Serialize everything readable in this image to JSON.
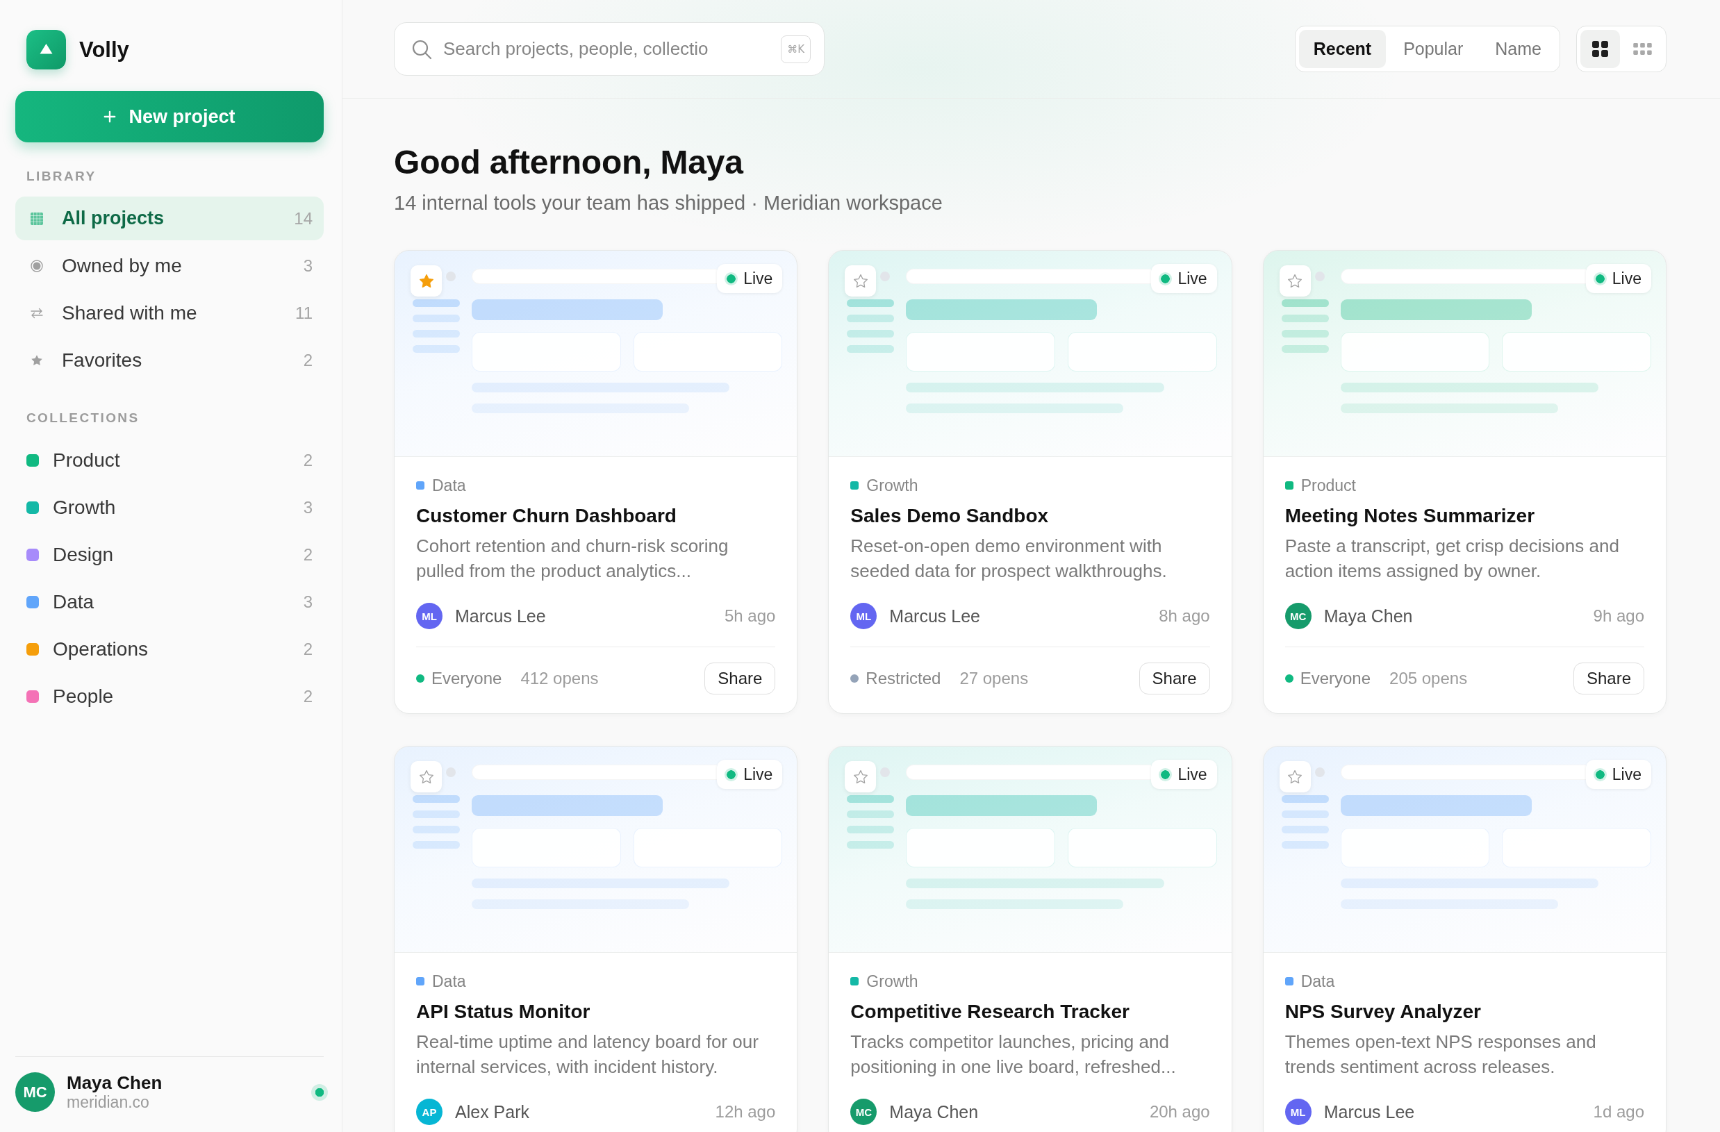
{
  "sidebar": {
    "brand": "Volly",
    "new_project": "New project",
    "library": {
      "heading": "LIBRARY",
      "items": [
        {
          "label": "All projects",
          "count": "14",
          "selected": true
        },
        {
          "label": "Owned by me",
          "count": "3",
          "selected": false
        },
        {
          "label": "Shared with me",
          "count": "11",
          "selected": false
        },
        {
          "label": "Favorites",
          "count": "2",
          "selected": false
        }
      ]
    },
    "collections": {
      "heading": "COLLECTIONS",
      "items": [
        {
          "label": "Product",
          "count": "2",
          "color": "#10b981",
          "selected": false
        },
        {
          "label": "Growth",
          "count": "3",
          "color": "#14b8a6",
          "selected": false
        },
        {
          "label": "Design",
          "count": "2",
          "color": "#a78bfa",
          "selected": false
        },
        {
          "label": "Data",
          "count": "3",
          "color": "#60a5fa",
          "selected": false
        },
        {
          "label": "Operations",
          "count": "2",
          "color": "#f59e0b",
          "selected": false
        },
        {
          "label": "People",
          "count": "2",
          "color": "#f472b6",
          "selected": false
        }
      ]
    },
    "user": {
      "initials": "MC",
      "name": "Maya Chen",
      "org": "meridian.co",
      "color": "#169b6b",
      "online": true
    }
  },
  "topbar": {
    "search": {
      "placeholder": "Search projects, people, collectio",
      "shortcut": "⌘K"
    },
    "sort_tabs": [
      {
        "label": "Recent",
        "selected": true
      },
      {
        "label": "Popular",
        "selected": false
      },
      {
        "label": "Name",
        "selected": false
      }
    ],
    "view_toggle": [
      {
        "selected": true
      },
      {
        "selected": false
      }
    ]
  },
  "header": {
    "title": "Good afternoon, Maya",
    "subtitle": "14 internal tools your team has shipped · Meridian workspace"
  },
  "projects": [
    {
      "category": {
        "label": "Data",
        "color": "#60a5fa"
      },
      "favorite": true,
      "status": "Live",
      "title": "Customer Churn Dashboard",
      "description": "Cohort retention and churn-risk scoring pulled from the product analytics...",
      "author": {
        "initials": "ML",
        "name": "Marcus Lee",
        "color": "#6366f1"
      },
      "updated": "5h ago",
      "access": {
        "label": "Everyone",
        "color": "#10b981"
      },
      "opens": "412 opens",
      "share": "Share"
    },
    {
      "category": {
        "label": "Growth",
        "color": "#14b8a6"
      },
      "favorite": false,
      "status": "Live",
      "title": "Sales Demo Sandbox",
      "description": "Reset-on-open demo environment with seeded data for prospect walkthroughs.",
      "author": {
        "initials": "ML",
        "name": "Marcus Lee",
        "color": "#6366f1"
      },
      "updated": "8h ago",
      "access": {
        "label": "Restricted",
        "color": "#94a3b8"
      },
      "opens": "27 opens",
      "share": "Share"
    },
    {
      "category": {
        "label": "Product",
        "color": "#10b981"
      },
      "favorite": false,
      "status": "Live",
      "title": "Meeting Notes Summarizer",
      "description": "Paste a transcript, get crisp decisions and action items assigned by owner.",
      "author": {
        "initials": "MC",
        "name": "Maya Chen",
        "color": "#169b6b"
      },
      "updated": "9h ago",
      "access": {
        "label": "Everyone",
        "color": "#10b981"
      },
      "opens": "205 opens",
      "share": "Share"
    },
    {
      "category": {
        "label": "Data",
        "color": "#60a5fa"
      },
      "favorite": false,
      "status": "Live",
      "title": "API Status Monitor",
      "description": "Real-time uptime and latency board for our internal services, with incident history.",
      "author": {
        "initials": "AP",
        "name": "Alex Park",
        "color": "#06b6d4"
      },
      "updated": "12h ago"
    },
    {
      "category": {
        "label": "Growth",
        "color": "#14b8a6"
      },
      "favorite": false,
      "status": "Live",
      "title": "Competitive Research Tracker",
      "description": "Tracks competitor launches, pricing and positioning in one live board, refreshed...",
      "author": {
        "initials": "MC",
        "name": "Maya Chen",
        "color": "#169b6b"
      },
      "updated": "20h ago"
    },
    {
      "category": {
        "label": "Data",
        "color": "#60a5fa"
      },
      "favorite": false,
      "status": "Live",
      "title": "NPS Survey Analyzer",
      "description": "Themes open-text NPS responses and trends sentiment across releases.",
      "author": {
        "initials": "ML",
        "name": "Marcus Lee",
        "color": "#6366f1"
      },
      "updated": "1d ago"
    }
  ]
}
